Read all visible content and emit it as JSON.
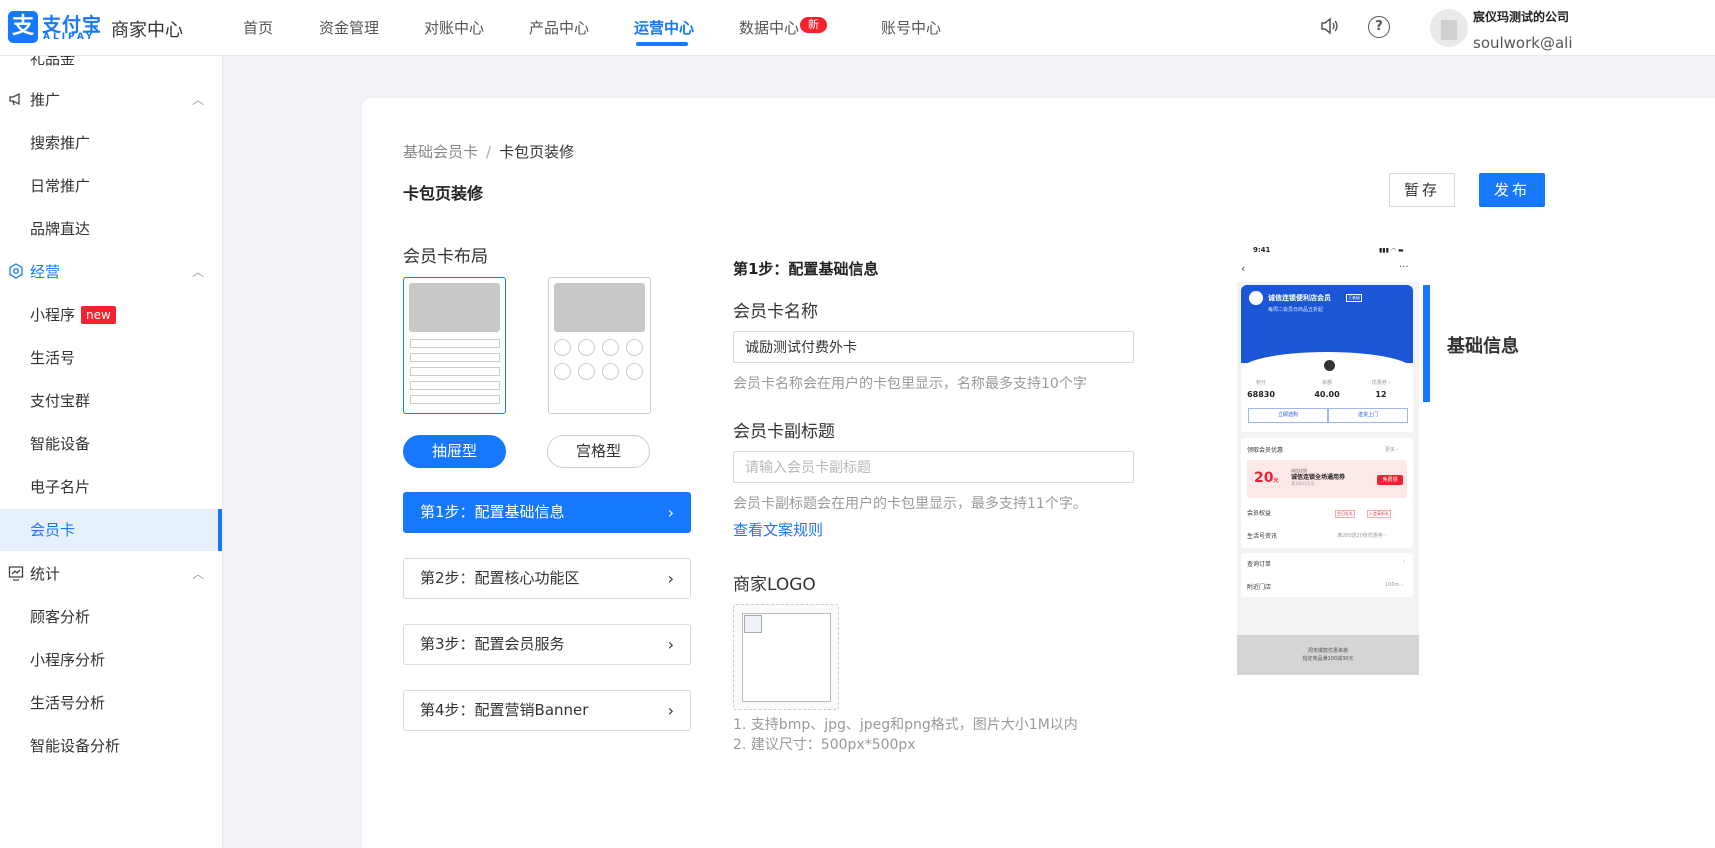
{
  "topbar": {
    "brand": "支付宝",
    "brand_sub": "ALIPAY",
    "app_title": "商家中心",
    "nav": [
      "首页",
      "资金管理",
      "对账中心",
      "产品中心",
      "运营中心",
      "数据中心",
      "账号中心"
    ],
    "nav_active": "运营中心",
    "new_badge": "新",
    "company": "宸仪玛测试的公司",
    "email": "soulwork@ali"
  },
  "sidebar": {
    "partial_top": "礼品金",
    "group_promo": "推广",
    "promo_items": [
      "搜索推广",
      "日常推广",
      "品牌直达"
    ],
    "group_ops": "经营",
    "ops_items": [
      "小程序",
      "生活号",
      "支付宝群",
      "智能设备",
      "电子名片",
      "会员卡"
    ],
    "new_tag": "new",
    "selected": "会员卡",
    "group_stats": "统计",
    "stats_items": [
      "顾客分析",
      "小程序分析",
      "生活号分析",
      "智能设备分析"
    ]
  },
  "main": {
    "breadcrumb": [
      "基础会员卡",
      "卡包页装修"
    ],
    "breadcrumb_sep": "/",
    "title": "卡包页装修",
    "save_btn": "暂存",
    "publish_btn": "发布",
    "layout_title": "会员卡布局",
    "layout_options": [
      "抽屉型",
      "宫格型"
    ],
    "layout_selected": "抽屉型",
    "steps": [
      "第1步：配置基础信息",
      "第2步：配置核心功能区",
      "第3步：配置会员服务",
      "第4步：配置营销Banner"
    ],
    "active_step": 1
  },
  "form": {
    "step_title": "第1步：配置基础信息",
    "name_label": "会员卡名称",
    "name_value": "诚励测试付费外卡",
    "name_hint": "会员卡名称会在用户的卡包里显示，名称最多支持10个字",
    "subtitle_label": "会员卡副标题",
    "subtitle_placeholder": "请输入会员卡副标题",
    "subtitle_hint": "会员卡副标题会在用户的卡包里显示，最多支持11个字。",
    "rules_link": "查看文案规则",
    "logo_label": "商家LOGO",
    "logo_hint_1": "1. 支持bmp、jpg、jpeg和png格式，图片大小1M以内",
    "logo_hint_2": "2. 建议尺寸：500px*500px"
  },
  "preview": {
    "time": "9:41",
    "card_name": "诚信连锁便利店会员",
    "card_tag": "王者级",
    "card_sub": "每周二会员日商品五折起",
    "stats": [
      {
        "label": "积分",
        "value": "68830"
      },
      {
        "label": "余额",
        "value": "40.00"
      },
      {
        "label": "优惠券 ›",
        "value": "12"
      }
    ],
    "btn_left": "立即选购",
    "btn_right": "送货上门",
    "coupon_section": "领取会员优惠",
    "more": "更多 ›",
    "coupon_amount": "20",
    "coupon_unit": "元",
    "coupon_shop": "诚信连锁",
    "coupon_title": "诚信连锁全场通用券",
    "coupon_cond": "满100元可用",
    "coupon_btn": "免费领",
    "benefits": "会员权益",
    "benefit_tags": [
      "生日礼礼",
      "入会享折礼"
    ],
    "life_news": "生活号资讯",
    "life_news_r": "满200送20张优惠券 ›",
    "orders": "查询订单",
    "nearby": "附近门店",
    "nearby_r": "100m ›",
    "footer_1": "周末爆款优惠来袭",
    "footer_2": "指定商品满100减30元"
  },
  "section_label": "基础信息",
  "colors": {
    "accent": "#1677ff",
    "badge": "#f5222d"
  }
}
